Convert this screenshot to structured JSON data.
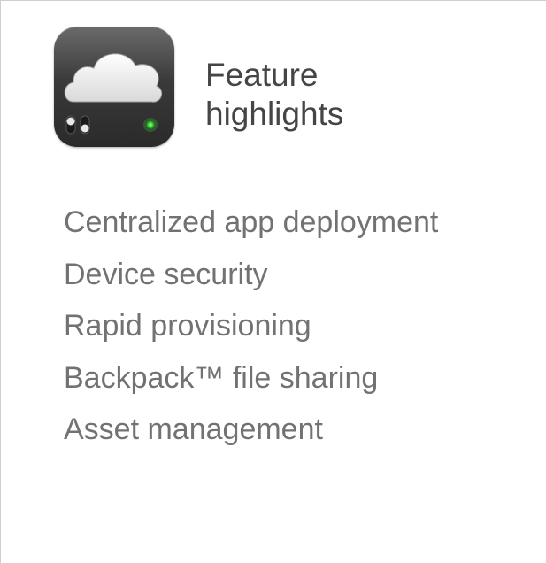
{
  "header": {
    "icon": "cloud-server-app-icon",
    "title_line1": "Feature",
    "title_line2": "highlights"
  },
  "features": [
    "Centralized app deployment",
    "Device security",
    "Rapid provisioning",
    "Backpack™ file sharing",
    "Asset management"
  ],
  "colors": {
    "title": "#454545",
    "feature_text": "#727272",
    "status_led": "#3ee03a"
  }
}
